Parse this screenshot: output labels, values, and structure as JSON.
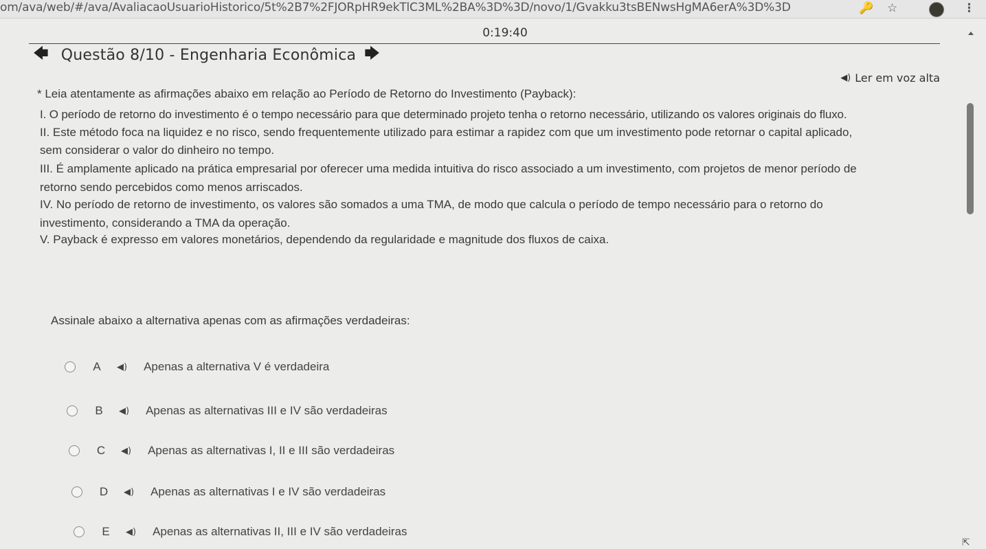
{
  "browser": {
    "url": "om/ava/web/#/ava/AvaliacaoUsuarioHistorico/5t%2B7%2FJORpHR9ekTlC3ML%2BA%3D%3D/novo/1/Gvakku3tsBENwsHgMA6erA%3D%3D",
    "key_icon": "🔑",
    "star_icon": "☆",
    "menu_icon": "⋮"
  },
  "header": {
    "timer": "0:19:40",
    "title": "Questão 8/10 - Engenharia Econômica",
    "back_arrow": "🡄",
    "forward_arrow": "🡆",
    "read_aloud_label": "Ler em voz alta",
    "speaker_icon": "◀)"
  },
  "question": {
    "intro": "* Leia atentamente as afirmações abaixo em relação ao Período de Retorno do Investimento (Payback):",
    "lines": [
      "I. O período de retorno do investimento é o tempo necessário para que determinado projeto tenha o retorno necessário, utilizando os valores originais do fluxo.",
      "II. Este método foca na liquidez e no risco, sendo frequentemente utilizado para estimar a rapidez com que um investimento pode retornar o capital aplicado,",
      "sem considerar o valor do dinheiro no tempo.",
      "III. É amplamente aplicado na prática empresarial por oferecer uma medida intuitiva do risco associado a um investimento, com projetos de menor período de",
      "retorno sendo percebidos como menos arriscados.",
      "IV. No período de retorno de investimento, os valores são somados a uma TMA, de modo que calcula o período de tempo necessário para o retorno do",
      "investimento, considerando a TMA da operação.",
      "V. Payback é expresso em valores monetários, dependendo da regularidade e magnitude dos fluxos de caixa."
    ],
    "instruction": "Assinale abaixo a alternativa apenas com as afirmações verdadeiras:"
  },
  "options": [
    {
      "letter": "A",
      "text": "Apenas a alternativa V é verdadeira"
    },
    {
      "letter": "B",
      "text": "Apenas as alternativas III e IV são verdadeiras"
    },
    {
      "letter": "C",
      "text": "Apenas as alternativas I, II e III são verdadeiras"
    },
    {
      "letter": "D",
      "text": "Apenas as alternativas I e IV são verdadeiras"
    },
    {
      "letter": "E",
      "text": "Apenas as alternativas II, III e IV são verdadeiras"
    }
  ]
}
